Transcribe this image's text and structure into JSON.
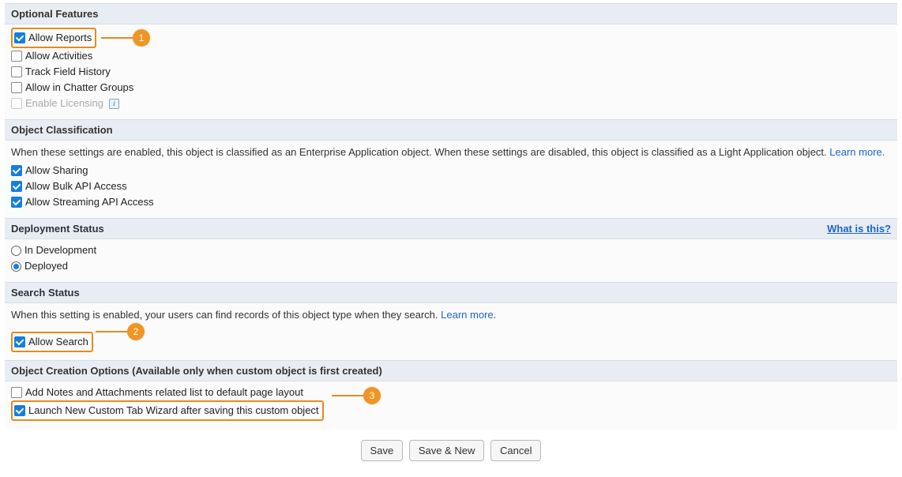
{
  "sections": {
    "optional": {
      "title": "Optional Features",
      "items": [
        {
          "label": "Allow Reports",
          "checked": true,
          "highlighted": true
        },
        {
          "label": "Allow Activities",
          "checked": false
        },
        {
          "label": "Track Field History",
          "checked": false
        },
        {
          "label": "Allow in Chatter Groups",
          "checked": false
        },
        {
          "label": "Enable Licensing",
          "checked": false,
          "disabled": true,
          "info": true
        }
      ]
    },
    "classification": {
      "title": "Object Classification",
      "description": "When these settings are enabled, this object is classified as an Enterprise Application object. When these settings are disabled, this object is classified as a Light Application object. ",
      "learn_more": "Learn more.",
      "items": [
        {
          "label": "Allow Sharing",
          "checked": true
        },
        {
          "label": "Allow Bulk API Access",
          "checked": true
        },
        {
          "label": "Allow Streaming API Access",
          "checked": true
        }
      ]
    },
    "deployment": {
      "title": "Deployment Status",
      "help": "What is this?",
      "options": [
        {
          "label": "In Development",
          "selected": false
        },
        {
          "label": "Deployed",
          "selected": true
        }
      ]
    },
    "search": {
      "title": "Search Status",
      "description": "When this setting is enabled, your users can find records of this object type when they search. ",
      "learn_more": "Learn more.",
      "item": {
        "label": "Allow Search",
        "checked": true,
        "highlighted": true
      }
    },
    "creation": {
      "title": "Object Creation Options (Available only when custom object is first created)",
      "items": [
        {
          "label": "Add Notes and Attachments related list to default page layout",
          "checked": false
        },
        {
          "label": "Launch New Custom Tab Wizard after saving this custom object",
          "checked": true,
          "highlighted": true
        }
      ]
    }
  },
  "buttons": {
    "save": "Save",
    "save_new": "Save & New",
    "cancel": "Cancel"
  },
  "callouts": [
    "1",
    "2",
    "3"
  ]
}
